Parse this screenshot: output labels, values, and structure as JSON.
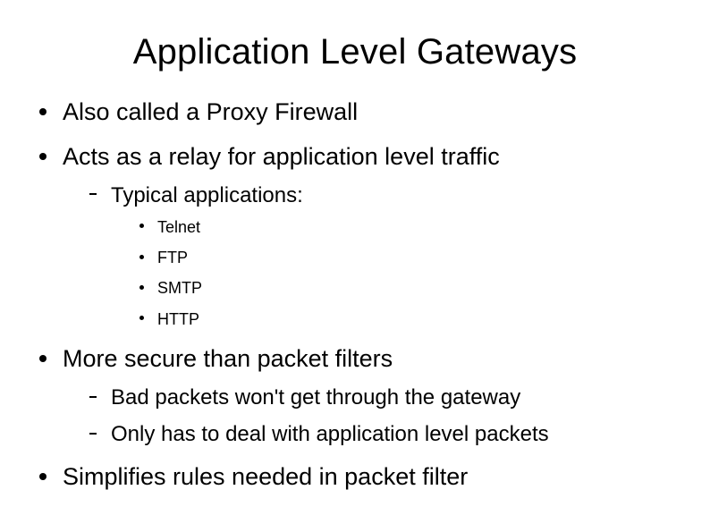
{
  "slide": {
    "title": "Application Level Gateways",
    "bullets": [
      {
        "text": "Also called a Proxy Firewall"
      },
      {
        "text": "Acts as a relay for application level traffic",
        "sub": [
          {
            "text": "Typical applications:",
            "sub": [
              {
                "text": "Telnet"
              },
              {
                "text": "FTP"
              },
              {
                "text": "SMTP"
              },
              {
                "text": "HTTP"
              }
            ]
          }
        ]
      },
      {
        "text": "More secure than packet filters",
        "sub": [
          {
            "text": "Bad packets won't get through the gateway"
          },
          {
            "text": "Only has to deal with application level packets"
          }
        ]
      },
      {
        "text": "Simplifies rules needed in packet filter"
      }
    ]
  }
}
